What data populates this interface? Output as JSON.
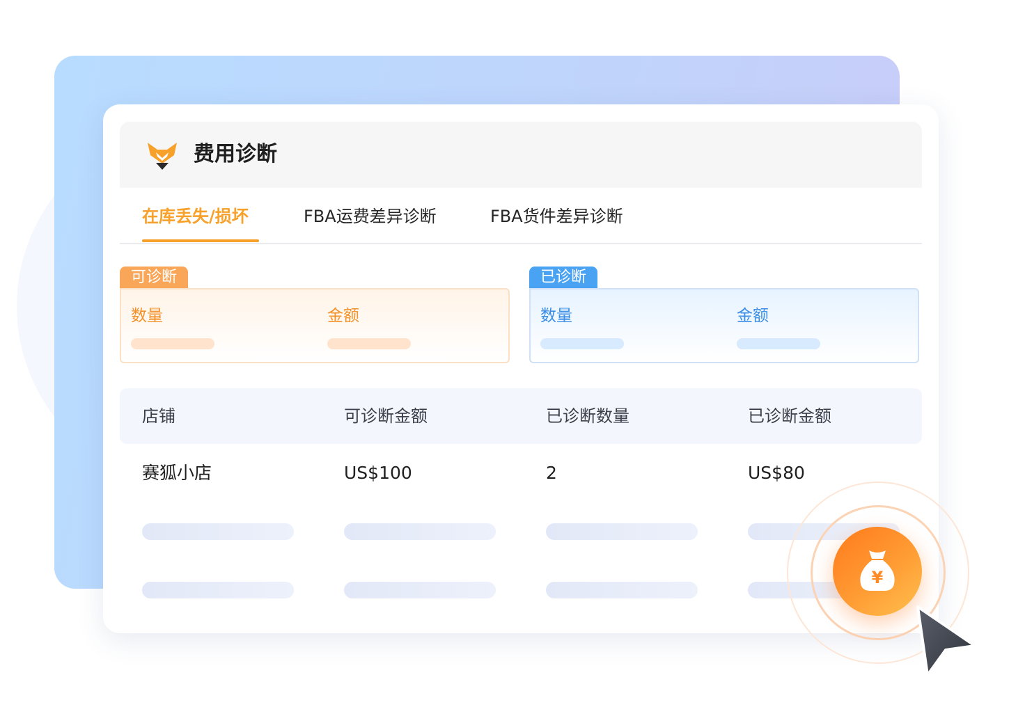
{
  "card": {
    "title": "费用诊断"
  },
  "tabs": [
    {
      "label": "在库丢失/损坏",
      "active": true
    },
    {
      "label": "FBA运费差异诊断",
      "active": false
    },
    {
      "label": "FBA货件差异诊断",
      "active": false
    }
  ],
  "stats": {
    "diagnosable": {
      "tag": "可诊断",
      "quantity_label": "数量",
      "amount_label": "金额",
      "color": "#f9a659"
    },
    "diagnosed": {
      "tag": "已诊断",
      "quantity_label": "数量",
      "amount_label": "金额",
      "color": "#4aa3f2"
    }
  },
  "table": {
    "headers": [
      "店铺",
      "可诊断金额",
      "已诊断数量",
      "已诊断金额"
    ],
    "rows": [
      [
        "赛狐小店",
        "US$100",
        "2",
        "US$80"
      ]
    ]
  },
  "fab": {
    "icon": "money-bag-icon",
    "symbol": "¥"
  },
  "colors": {
    "accent": "#f7a02a",
    "blue": "#3b8ee6"
  }
}
